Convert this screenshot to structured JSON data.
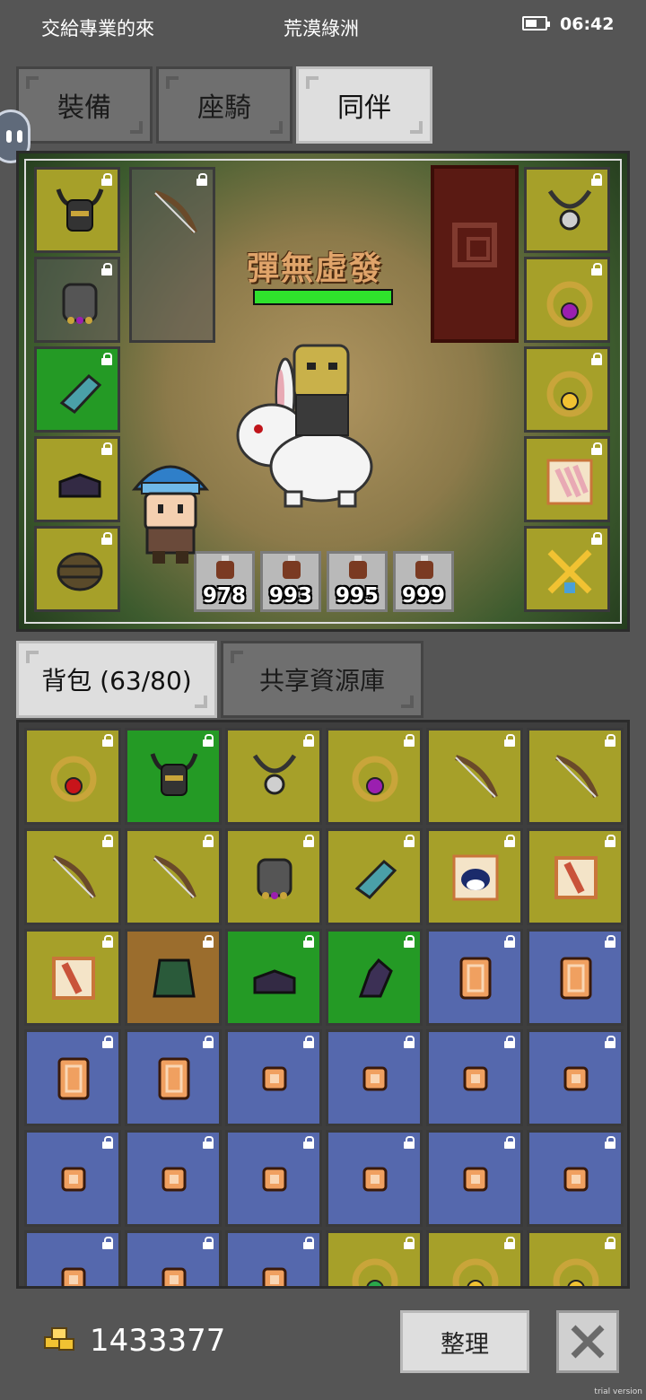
{
  "status_bar": {
    "left_text": "交給專業的來",
    "location": "荒漠綠洲",
    "time": "06:42",
    "battery_level": 0.6
  },
  "equip_tabs": [
    {
      "label": "裝備",
      "active": false
    },
    {
      "label": "座騎",
      "active": false
    },
    {
      "label": "同伴",
      "active": true
    }
  ],
  "scene": {
    "skill_name": "彈無虛發",
    "hp_fraction": 1.0,
    "left_slots": [
      {
        "icon": "horned-helmet-icon",
        "color": "olive"
      },
      {
        "icon": "armor-icon",
        "color": "gray"
      },
      {
        "icon": "gauntlet-icon",
        "color": "green"
      },
      {
        "icon": "boots-icon",
        "color": "olive"
      },
      {
        "icon": "belt-icon",
        "color": "olive"
      }
    ],
    "weapon_slot": {
      "icon": "bow-icon",
      "color": "gray"
    },
    "right_slots": [
      {
        "icon": "amulet-icon",
        "color": "olive"
      },
      {
        "icon": "ring-purple-icon",
        "color": "olive"
      },
      {
        "icon": "ring-gold-icon",
        "color": "olive"
      },
      {
        "icon": "wing-icon",
        "color": "olive"
      },
      {
        "icon": "crossed-swords-icon",
        "color": "olive"
      }
    ],
    "potions": [
      "978",
      "993",
      "995",
      "999"
    ]
  },
  "bag_tabs": [
    {
      "label": "背包 (63/80)",
      "active": true
    },
    {
      "label": "共享資源庫",
      "active": false
    }
  ],
  "inventory": [
    {
      "icon": "ring-red-icon",
      "color": "olive"
    },
    {
      "icon": "horned-helmet-icon",
      "color": "green"
    },
    {
      "icon": "amulet-icon",
      "color": "olive"
    },
    {
      "icon": "ring-purple-icon",
      "color": "olive"
    },
    {
      "icon": "bow-icon",
      "color": "olive"
    },
    {
      "icon": "bow-icon",
      "color": "olive"
    },
    {
      "icon": "bow-icon",
      "color": "olive"
    },
    {
      "icon": "bow-icon",
      "color": "olive"
    },
    {
      "icon": "armor-icon",
      "color": "olive"
    },
    {
      "icon": "gauntlet-icon",
      "color": "olive"
    },
    {
      "icon": "magpie-icon",
      "color": "olive"
    },
    {
      "icon": "scroll-icon",
      "color": "olive"
    },
    {
      "icon": "scroll-icon",
      "color": "olive"
    },
    {
      "icon": "cloak-icon",
      "color": "brown"
    },
    {
      "icon": "boots-icon",
      "color": "green"
    },
    {
      "icon": "glove-icon",
      "color": "green"
    },
    {
      "icon": "card-icon",
      "color": "blue"
    },
    {
      "icon": "card-icon",
      "color": "blue"
    },
    {
      "icon": "card-icon",
      "color": "blue"
    },
    {
      "icon": "card-icon",
      "color": "blue"
    },
    {
      "icon": "coin-icon",
      "color": "blue"
    },
    {
      "icon": "coin-icon",
      "color": "blue"
    },
    {
      "icon": "coin-icon",
      "color": "blue"
    },
    {
      "icon": "coin-icon",
      "color": "blue"
    },
    {
      "icon": "coin-icon",
      "color": "blue"
    },
    {
      "icon": "coin-icon",
      "color": "blue"
    },
    {
      "icon": "coin-icon",
      "color": "blue"
    },
    {
      "icon": "coin-icon",
      "color": "blue"
    },
    {
      "icon": "coin-icon",
      "color": "blue"
    },
    {
      "icon": "coin-icon",
      "color": "blue"
    },
    {
      "icon": "coin-icon",
      "color": "blue"
    },
    {
      "icon": "coin-icon",
      "color": "blue"
    },
    {
      "icon": "coin-icon",
      "color": "blue"
    },
    {
      "icon": "ring-green-icon",
      "color": "olive"
    },
    {
      "icon": "ring-gold-icon",
      "color": "olive"
    },
    {
      "icon": "ring-gold-icon",
      "color": "olive"
    },
    {
      "icon": "ring-gold-icon",
      "color": "olive"
    }
  ],
  "footer": {
    "gold": "1433377",
    "sort_label": "整理",
    "trial_label": "trial version"
  },
  "colors": {
    "olive": "#a6a029",
    "green": "#249a25",
    "blue": "#5568ad",
    "brown": "#9b6d2d",
    "gray": "#5a5a5a"
  }
}
